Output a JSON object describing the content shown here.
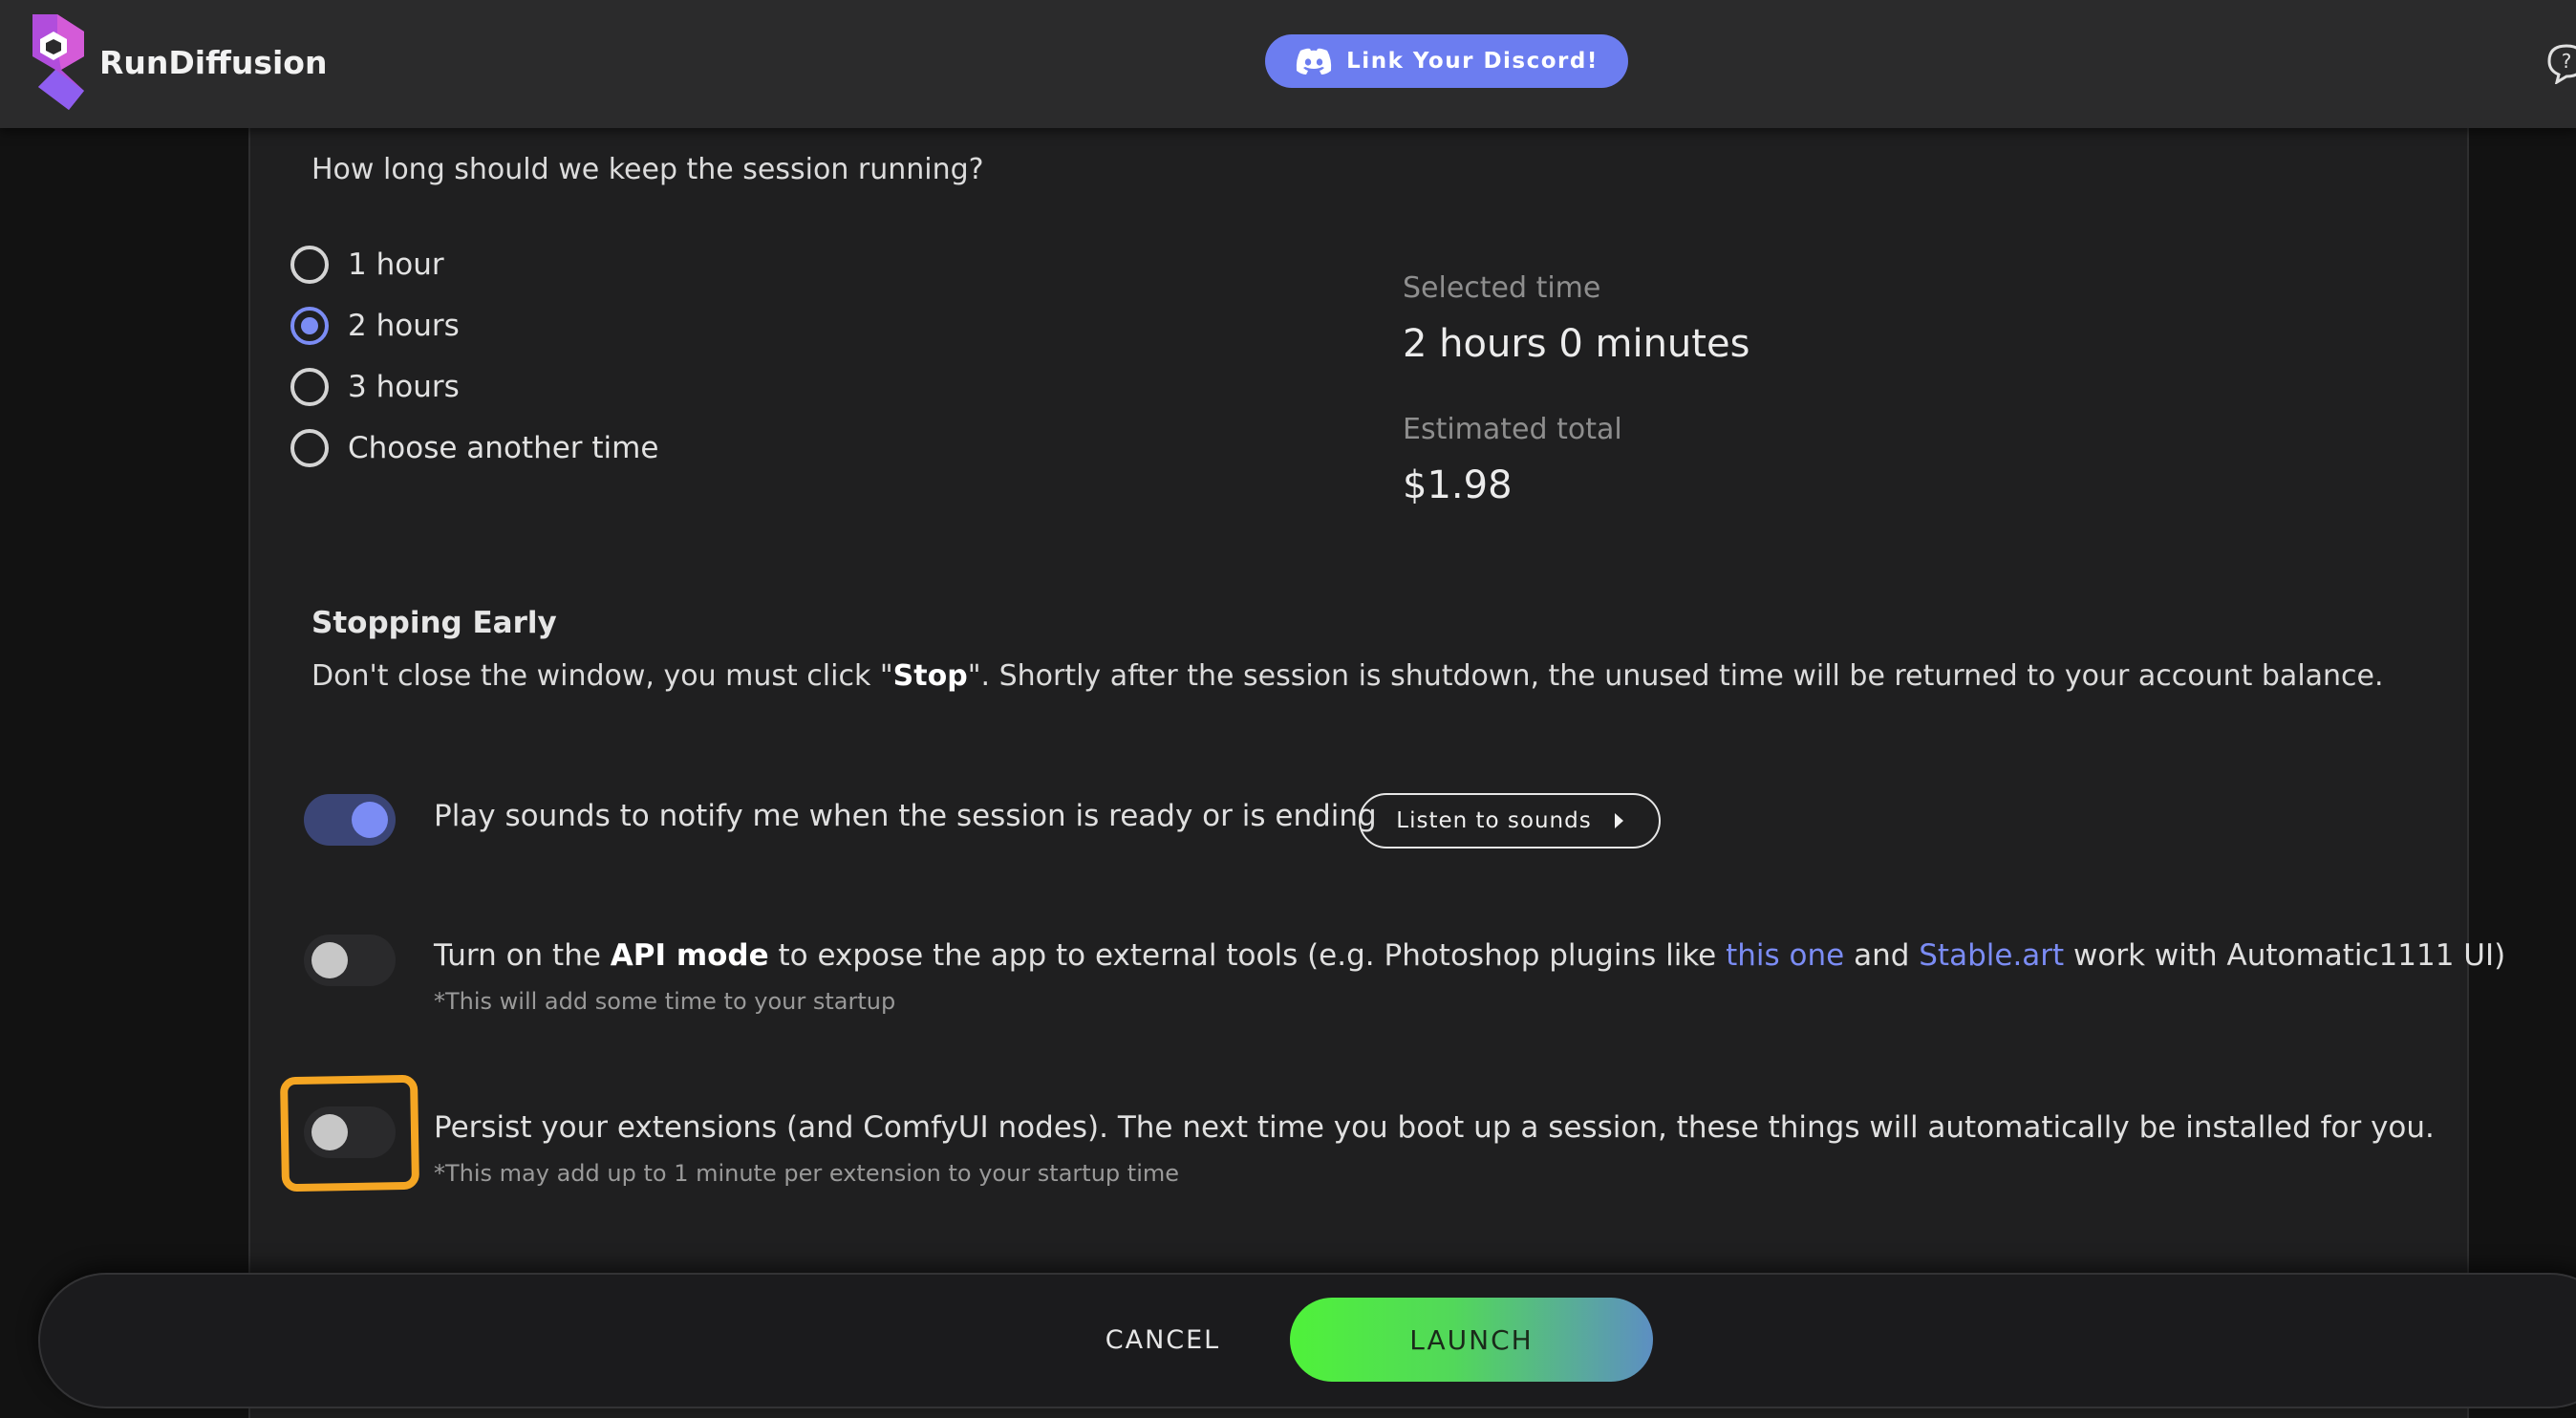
{
  "header": {
    "brand_name": "RunDiffusion",
    "discord_button": "Link Your Discord!"
  },
  "session": {
    "question": "How long should we keep the session running?",
    "options": [
      {
        "label": "1 hour",
        "checked": false
      },
      {
        "label": "2 hours",
        "checked": true
      },
      {
        "label": "3 hours",
        "checked": false
      },
      {
        "label": "Choose another time",
        "checked": false
      }
    ],
    "selected_time_label": "Selected time",
    "selected_time_value": "2 hours 0 minutes",
    "estimated_total_label": "Estimated total",
    "estimated_total_value": "$1.98"
  },
  "stopping_early": {
    "title": "Stopping Early",
    "text_before": "Don't close the window, you must click \"",
    "stop_word": "Stop",
    "text_after": "\". Shortly after the session is shutdown, the unused time will be returned to your account balance."
  },
  "options": {
    "sounds": {
      "enabled": true,
      "text": "Play sounds to notify me when the session is ready or is ending",
      "listen_button": "Listen to sounds"
    },
    "api_mode": {
      "enabled": false,
      "text_before": "Turn on the ",
      "bold": "API mode",
      "text_middle": " to expose the app to external tools (e.g. Photoshop plugins like ",
      "link1": "this one",
      "text_and": " and ",
      "link2": "Stable.art",
      "text_after": " work with Automatic1111 UI)",
      "note": "*This will add some time to your startup"
    },
    "persist": {
      "enabled": false,
      "text": "Persist your extensions (and ComfyUI nodes). The next time you boot up a session, these things will automatically be installed for you.",
      "note": "*This may add up to 1 minute per extension to your startup time"
    }
  },
  "footer": {
    "cancel": "CANCEL",
    "launch": "LAUNCH"
  },
  "colors": {
    "accent": "#7b8cf4",
    "highlight": "#f5a623",
    "launch_start": "#4ff23a",
    "launch_end": "#5d8fc2"
  }
}
